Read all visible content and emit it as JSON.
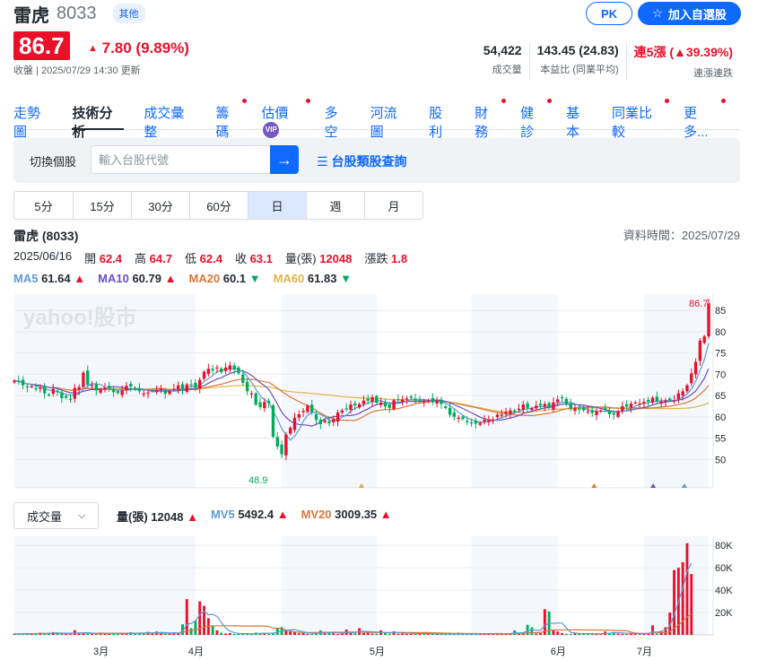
{
  "stock": {
    "name": "雷虎",
    "code": "8033",
    "tag": "其他"
  },
  "buttons": {
    "pk": "PK",
    "watchlist": "加入自選股"
  },
  "quote": {
    "price": "86.7",
    "change": "7.80 (9.89%)",
    "updated": "收盤 | 2025/07/29 14:30 更新"
  },
  "stats": [
    {
      "value": "54,422",
      "label": "成交量",
      "color": "#232a31"
    },
    {
      "value": "143.45 (24.83)",
      "label": "本益比 (同業平均)",
      "color": "#232a31"
    },
    {
      "value": "連5漲 (▲39.39%)",
      "label": "連漲連跌",
      "color": "#eb0f29"
    }
  ],
  "tabs": [
    {
      "label": "走勢圖",
      "dot": false,
      "vip": false,
      "active": false
    },
    {
      "label": "技術分析",
      "dot": false,
      "vip": false,
      "active": true
    },
    {
      "label": "成交彙整",
      "dot": false,
      "vip": false,
      "active": false
    },
    {
      "label": "籌碼",
      "dot": true,
      "vip": false,
      "active": false
    },
    {
      "label": "估價",
      "dot": true,
      "vip": true,
      "active": false
    },
    {
      "label": "多空",
      "dot": false,
      "vip": false,
      "active": false
    },
    {
      "label": "河流圖",
      "dot": false,
      "vip": false,
      "active": false
    },
    {
      "label": "股利",
      "dot": false,
      "vip": false,
      "active": false
    },
    {
      "label": "財務",
      "dot": true,
      "vip": false,
      "active": false
    },
    {
      "label": "健診",
      "dot": true,
      "vip": false,
      "active": false
    },
    {
      "label": "基本",
      "dot": false,
      "vip": false,
      "active": false
    },
    {
      "label": "同業比較",
      "dot": true,
      "vip": false,
      "active": false
    },
    {
      "label": "更多...",
      "dot": true,
      "vip": false,
      "active": false
    }
  ],
  "vip_badge": "VIP",
  "search": {
    "label": "切換個股",
    "placeholder": "輸入台股代號",
    "category_link": "台股類股查詢"
  },
  "periods": [
    "5分",
    "15分",
    "30分",
    "60分",
    "日",
    "週",
    "月"
  ],
  "active_period": "日",
  "chart_header": {
    "title": "雷虎 (8033)",
    "data_time": "資料時間：2025/07/29",
    "date": "2025/06/16",
    "ohlc": [
      {
        "label": "開",
        "value": "62.4"
      },
      {
        "label": "高",
        "value": "64.7"
      },
      {
        "label": "低",
        "value": "62.4"
      },
      {
        "label": "收",
        "value": "63.1"
      },
      {
        "label": "量(張)",
        "value": "12048"
      },
      {
        "label": "漲跌",
        "value": "1.8"
      }
    ],
    "ma": [
      {
        "label": "MA5",
        "value": "61.64",
        "dir": "▲",
        "color": "#5b9bd5"
      },
      {
        "label": "MA10",
        "value": "60.79",
        "dir": "▲",
        "color": "#6a4fc4"
      },
      {
        "label": "MA20",
        "value": "60.1",
        "dir": "▼",
        "color": "#d9773a"
      },
      {
        "label": "MA60",
        "value": "61.83",
        "dir": "▼",
        "color": "#e0b44a"
      }
    ]
  },
  "volume_header": {
    "selector": "成交量",
    "items": [
      {
        "label": "量(張)",
        "value": "12048",
        "dir": "▲",
        "color": "#232a31"
      },
      {
        "label": "MV5",
        "value": "5492.4",
        "dir": "▲",
        "color": "#5b9bd5"
      },
      {
        "label": "MV20",
        "value": "3009.35",
        "dir": "▲",
        "color": "#d9773a"
      }
    ]
  },
  "chart_data": {
    "type": "candlestick",
    "price_axis": {
      "ticks": [
        50,
        55,
        60,
        65,
        70,
        75,
        80,
        85
      ],
      "range": [
        45,
        88
      ]
    },
    "volume_axis": {
      "ticks": [
        "20K",
        "40K",
        "60K",
        "80K"
      ],
      "range": [
        0,
        85000
      ]
    },
    "x_labels": [
      "3月",
      "4月",
      "5月",
      "6月",
      "7月"
    ],
    "annotations": {
      "high": "86.7",
      "low": "48.9"
    },
    "watermark": "yahoo!股市",
    "closes": [
      68.5,
      68.2,
      67.4,
      66.9,
      67.2,
      66.6,
      66.8,
      65.5,
      65.2,
      66.6,
      65.8,
      64.4,
      64.5,
      64.0,
      66.8,
      67.0,
      70.4,
      67.5,
      67.5,
      66.2,
      66.4,
      66.8,
      66.8,
      65.8,
      65.6,
      66.2,
      67.3,
      67.1,
      66.5,
      66.0,
      65.5,
      65.7,
      66.1,
      66.2,
      66.6,
      65.4,
      66.1,
      66.6,
      67.4,
      66.4,
      67.6,
      67.5,
      66.9,
      68.7,
      70.6,
      71.3,
      70.9,
      71.6,
      70.5,
      71.6,
      72.1,
      71.1,
      70.2,
      68.0,
      66.0,
      65.5,
      62.9,
      62.3,
      63.5,
      63.2,
      55.3,
      53.0,
      51.2,
      55.8,
      57.4,
      59.8,
      60.6,
      61.4,
      62.6,
      61.1,
      59.3,
      58.3,
      59.2,
      58.5,
      59.4,
      61.0,
      61.5,
      61.9,
      62.9,
      62.7,
      63.0,
      63.8,
      63.8,
      64.6,
      63.3,
      63.4,
      62.4,
      62.1,
      63.9,
      64.0,
      64.1,
      64.3,
      64.5,
      63.8,
      64.0,
      63.6,
      63.9,
      63.4,
      63.8,
      63.0,
      62.1,
      60.5,
      60.0,
      59.8,
      59.5,
      58.7,
      58.6,
      58.4,
      58.6,
      59.3,
      59.4,
      59.4,
      60.5,
      60.5,
      61.2,
      61.5,
      61.1,
      61.9,
      62.9,
      62.1,
      62.0,
      62.6,
      62.7,
      63.0,
      62.2,
      63.4,
      64.1,
      64.5,
      62.9,
      61.9,
      62.0,
      61.7,
      61.5,
      61.3,
      60.9,
      61.3,
      61.5,
      61.7,
      60.6,
      60.5,
      61.3,
      62.5,
      62.4,
      63.1,
      63.4,
      63.1,
      63.5,
      63.6,
      64.5,
      63.6,
      63.6,
      63.8,
      63.9,
      63.9,
      65.5,
      66.0,
      67.4,
      70.2,
      72.9,
      77.9,
      78.9,
      86.7
    ],
    "volumes": [
      1000,
      800,
      1200,
      1500,
      900,
      1100,
      2000,
      1400,
      1800,
      2500,
      1300,
      1000,
      900,
      1600,
      4200,
      1200,
      1500,
      1000,
      900,
      1100,
      2100,
      1500,
      1300,
      1000,
      900,
      1300,
      1600,
      2400,
      1400,
      1200,
      1800,
      2600,
      1500,
      3000,
      1900,
      1000,
      1100,
      2200,
      1800,
      9500,
      32000,
      6000,
      13000,
      30000,
      26000,
      15000,
      8000,
      4000,
      2000,
      1200,
      1600,
      800,
      1300,
      1000,
      900,
      1200,
      2100,
      1500,
      1800,
      900,
      1300,
      6500,
      7000,
      4000,
      3500,
      2500,
      1400,
      1800,
      1000,
      900,
      1200,
      4000,
      1300,
      2500,
      1400,
      900,
      1200,
      4800,
      2000,
      1400,
      6000,
      1800,
      3300,
      1200,
      1100,
      4100,
      1600,
      1000,
      3200,
      1100,
      1300,
      900,
      1000,
      1400,
      2100,
      900,
      800,
      1000,
      900,
      1100,
      1300,
      900,
      700,
      1800,
      900,
      800,
      1000,
      1200,
      900,
      1500,
      800,
      1100,
      1600,
      900,
      1000,
      1400,
      4000,
      1700,
      2000,
      9000,
      6800,
      1200,
      1500,
      23000,
      21000,
      4500,
      3000,
      1700,
      1000,
      900,
      2000,
      1300,
      800,
      1100,
      1000,
      900,
      1200,
      3000,
      1600,
      2600,
      1100,
      1000,
      900,
      1500,
      1800,
      900,
      1100,
      1300,
      8500,
      1000,
      3500,
      6800,
      20000,
      58000,
      60000,
      65000,
      82000,
      54422
    ]
  }
}
